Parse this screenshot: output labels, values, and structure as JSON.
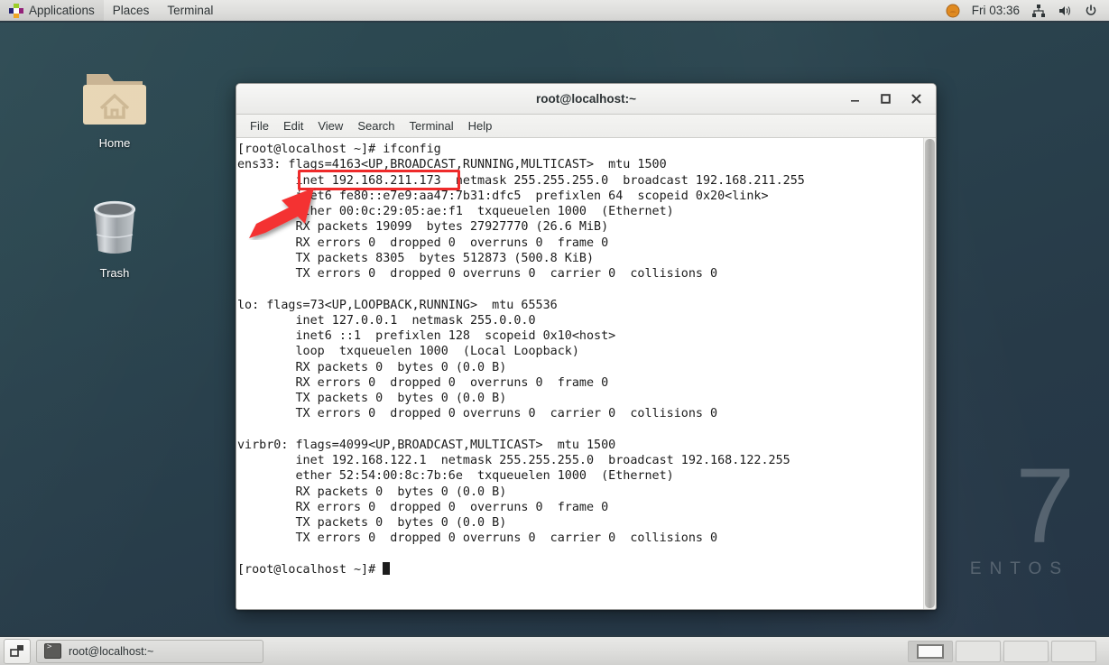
{
  "top_panel": {
    "logo_icon": "centos-pinwheel-icon",
    "menus": [
      "Applications",
      "Places",
      "Terminal"
    ],
    "clock": "Fri 03:36",
    "tray_icons": [
      "user-icon",
      "network-icon",
      "volume-icon",
      "power-icon"
    ]
  },
  "desktop": {
    "icons": [
      {
        "label": "Home",
        "icon": "home-folder-icon"
      },
      {
        "label": "Trash",
        "icon": "trash-can-icon"
      }
    ],
    "watermark": {
      "big": "7",
      "small": "ENTOS"
    }
  },
  "terminal": {
    "title": "root@localhost:~",
    "menus": [
      "File",
      "Edit",
      "View",
      "Search",
      "Terminal",
      "Help"
    ],
    "window_buttons": [
      "minimize-icon",
      "maximize-icon",
      "close-icon"
    ],
    "content": "[root@localhost ~]# ifconfig\nens33: flags=4163<UP,BROADCAST,RUNNING,MULTICAST>  mtu 1500\n        inet 192.168.211.173  netmask 255.255.255.0  broadcast 192.168.211.255\n        inet6 fe80::e7e9:aa47:7b31:dfc5  prefixlen 64  scopeid 0x20<link>\n        ether 00:0c:29:05:ae:f1  txqueuelen 1000  (Ethernet)\n        RX packets 19099  bytes 27927770 (26.6 MiB)\n        RX errors 0  dropped 0  overruns 0  frame 0\n        TX packets 8305  bytes 512873 (500.8 KiB)\n        TX errors 0  dropped 0 overruns 0  carrier 0  collisions 0\n\nlo: flags=73<UP,LOOPBACK,RUNNING>  mtu 65536\n        inet 127.0.0.1  netmask 255.0.0.0\n        inet6 ::1  prefixlen 128  scopeid 0x10<host>\n        loop  txqueuelen 1000  (Local Loopback)\n        RX packets 0  bytes 0 (0.0 B)\n        RX errors 0  dropped 0  overruns 0  frame 0\n        TX packets 0  bytes 0 (0.0 B)\n        TX errors 0  dropped 0 overruns 0  carrier 0  collisions 0\n\nvirbr0: flags=4099<UP,BROADCAST,MULTICAST>  mtu 1500\n        inet 192.168.122.1  netmask 255.255.255.0  broadcast 192.168.122.255\n        ether 52:54:00:8c:7b:6e  txqueuelen 1000  (Ethernet)\n        RX packets 0  bytes 0 (0.0 B)\n        RX errors 0  dropped 0  overruns 0  frame 0\n        TX packets 0  bytes 0 (0.0 B)\n        TX errors 0  dropped 0 overruns 0  carrier 0  collisions 0\n\n[root@localhost ~]# "
  },
  "annotations": {
    "highlight_color": "#ee2b2b",
    "highlighted_text": "inet 192.168.211.173",
    "arrow_color": "#f43030"
  },
  "taskbar": {
    "show_desktop_icon": "show-desktop-icon",
    "tasks": [
      {
        "label": "root@localhost:~",
        "icon": "terminal-icon"
      }
    ],
    "workspaces": [
      {
        "name": "workspace-1",
        "active": true
      },
      {
        "name": "workspace-2",
        "active": false
      },
      {
        "name": "workspace-3",
        "active": false
      },
      {
        "name": "workspace-4",
        "active": false
      }
    ]
  }
}
